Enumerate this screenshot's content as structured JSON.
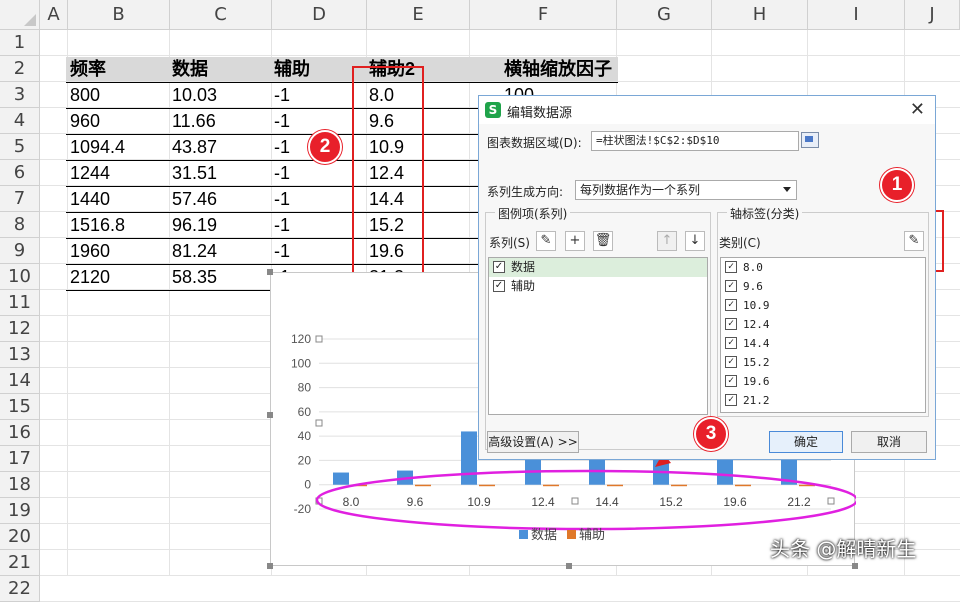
{
  "sheet": {
    "columns": [
      "A",
      "B",
      "C",
      "D",
      "E",
      "F",
      "G",
      "H",
      "I",
      "J"
    ],
    "rows": [
      "1",
      "2",
      "3",
      "4",
      "5",
      "6",
      "7",
      "8",
      "9",
      "10",
      "11",
      "12",
      "13",
      "14",
      "15",
      "16",
      "17",
      "18",
      "19",
      "20",
      "21",
      "22"
    ],
    "headers": [
      "频率",
      "数据",
      "辅助",
      "辅助2",
      "横轴缩放因子"
    ],
    "data": [
      [
        "800",
        "10.03",
        "-1",
        "8.0",
        "100"
      ],
      [
        "960",
        "11.66",
        "-1",
        "9.6",
        ""
      ],
      [
        "1094.4",
        "43.87",
        "-1",
        "10.9",
        ""
      ],
      [
        "1244",
        "31.51",
        "-1",
        "12.4",
        ""
      ],
      [
        "1440",
        "57.46",
        "-1",
        "14.4",
        ""
      ],
      [
        "1516.8",
        "96.19",
        "-1",
        "15.2",
        ""
      ],
      [
        "1960",
        "81.24",
        "-1",
        "19.6",
        ""
      ],
      [
        "2120",
        "58.35",
        "-1",
        "21.2",
        ""
      ]
    ]
  },
  "badges": {
    "one": "1",
    "two": "2",
    "three": "3"
  },
  "dialog": {
    "title": "编辑数据源",
    "range_label": "图表数据区域(D):",
    "range_value": "=柱状图法!$C$2:$D$10",
    "direction_label": "系列生成方向:",
    "direction_value": "每列数据作为一个系列",
    "legend_group": "图例项(系列)",
    "series_label": "系列(S)",
    "series": [
      "数据",
      "辅助"
    ],
    "axis_group": "轴标签(分类)",
    "category_label": "类别(C)",
    "categories": [
      "8.0",
      "9.6",
      "10.9",
      "12.4",
      "14.4",
      "15.2",
      "19.6",
      "21.2"
    ],
    "advanced": "高级设置(A) >>",
    "ok": "确定",
    "cancel": "取消"
  },
  "chart_data": {
    "type": "bar",
    "categories": [
      "8.0",
      "9.6",
      "10.9",
      "12.4",
      "14.4",
      "15.2",
      "19.6",
      "21.2"
    ],
    "series": [
      {
        "name": "数据",
        "values": [
          10.03,
          11.66,
          43.87,
          31.51,
          57.46,
          96.19,
          81.24,
          58.35
        ],
        "color": "#4a90d9"
      },
      {
        "name": "辅助",
        "values": [
          -1,
          -1,
          -1,
          -1,
          -1,
          -1,
          -1,
          -1
        ],
        "color": "#e0782a"
      }
    ],
    "yticks": [
      "120",
      "100",
      "80",
      "60",
      "40",
      "20",
      "0",
      "-20"
    ],
    "ylim": [
      -20,
      120
    ],
    "legend_position": "bottom"
  },
  "watermark": "头条 @解晴新生"
}
